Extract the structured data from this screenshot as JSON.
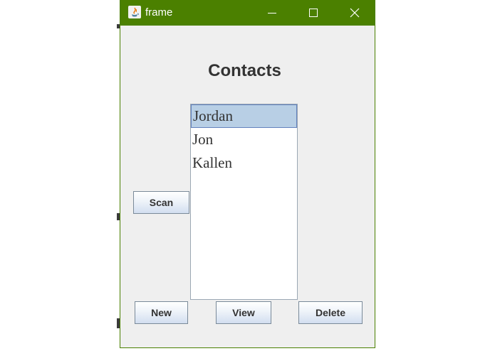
{
  "window": {
    "title": "frame",
    "titlebar_color": "#4b8000",
    "controls": {
      "minimize_icon": "minimize-icon",
      "maximize_icon": "maximize-icon",
      "close_icon": "close-icon"
    }
  },
  "main": {
    "heading": "Contacts",
    "contacts": [
      {
        "name": "Jordan",
        "selected": true
      },
      {
        "name": "Jon",
        "selected": false
      },
      {
        "name": "Kallen",
        "selected": false
      }
    ],
    "selection_color": "#b8cfe5"
  },
  "buttons": {
    "scan_label": "Scan",
    "new_label": "New",
    "view_label": "View",
    "delete_label": "Delete"
  }
}
